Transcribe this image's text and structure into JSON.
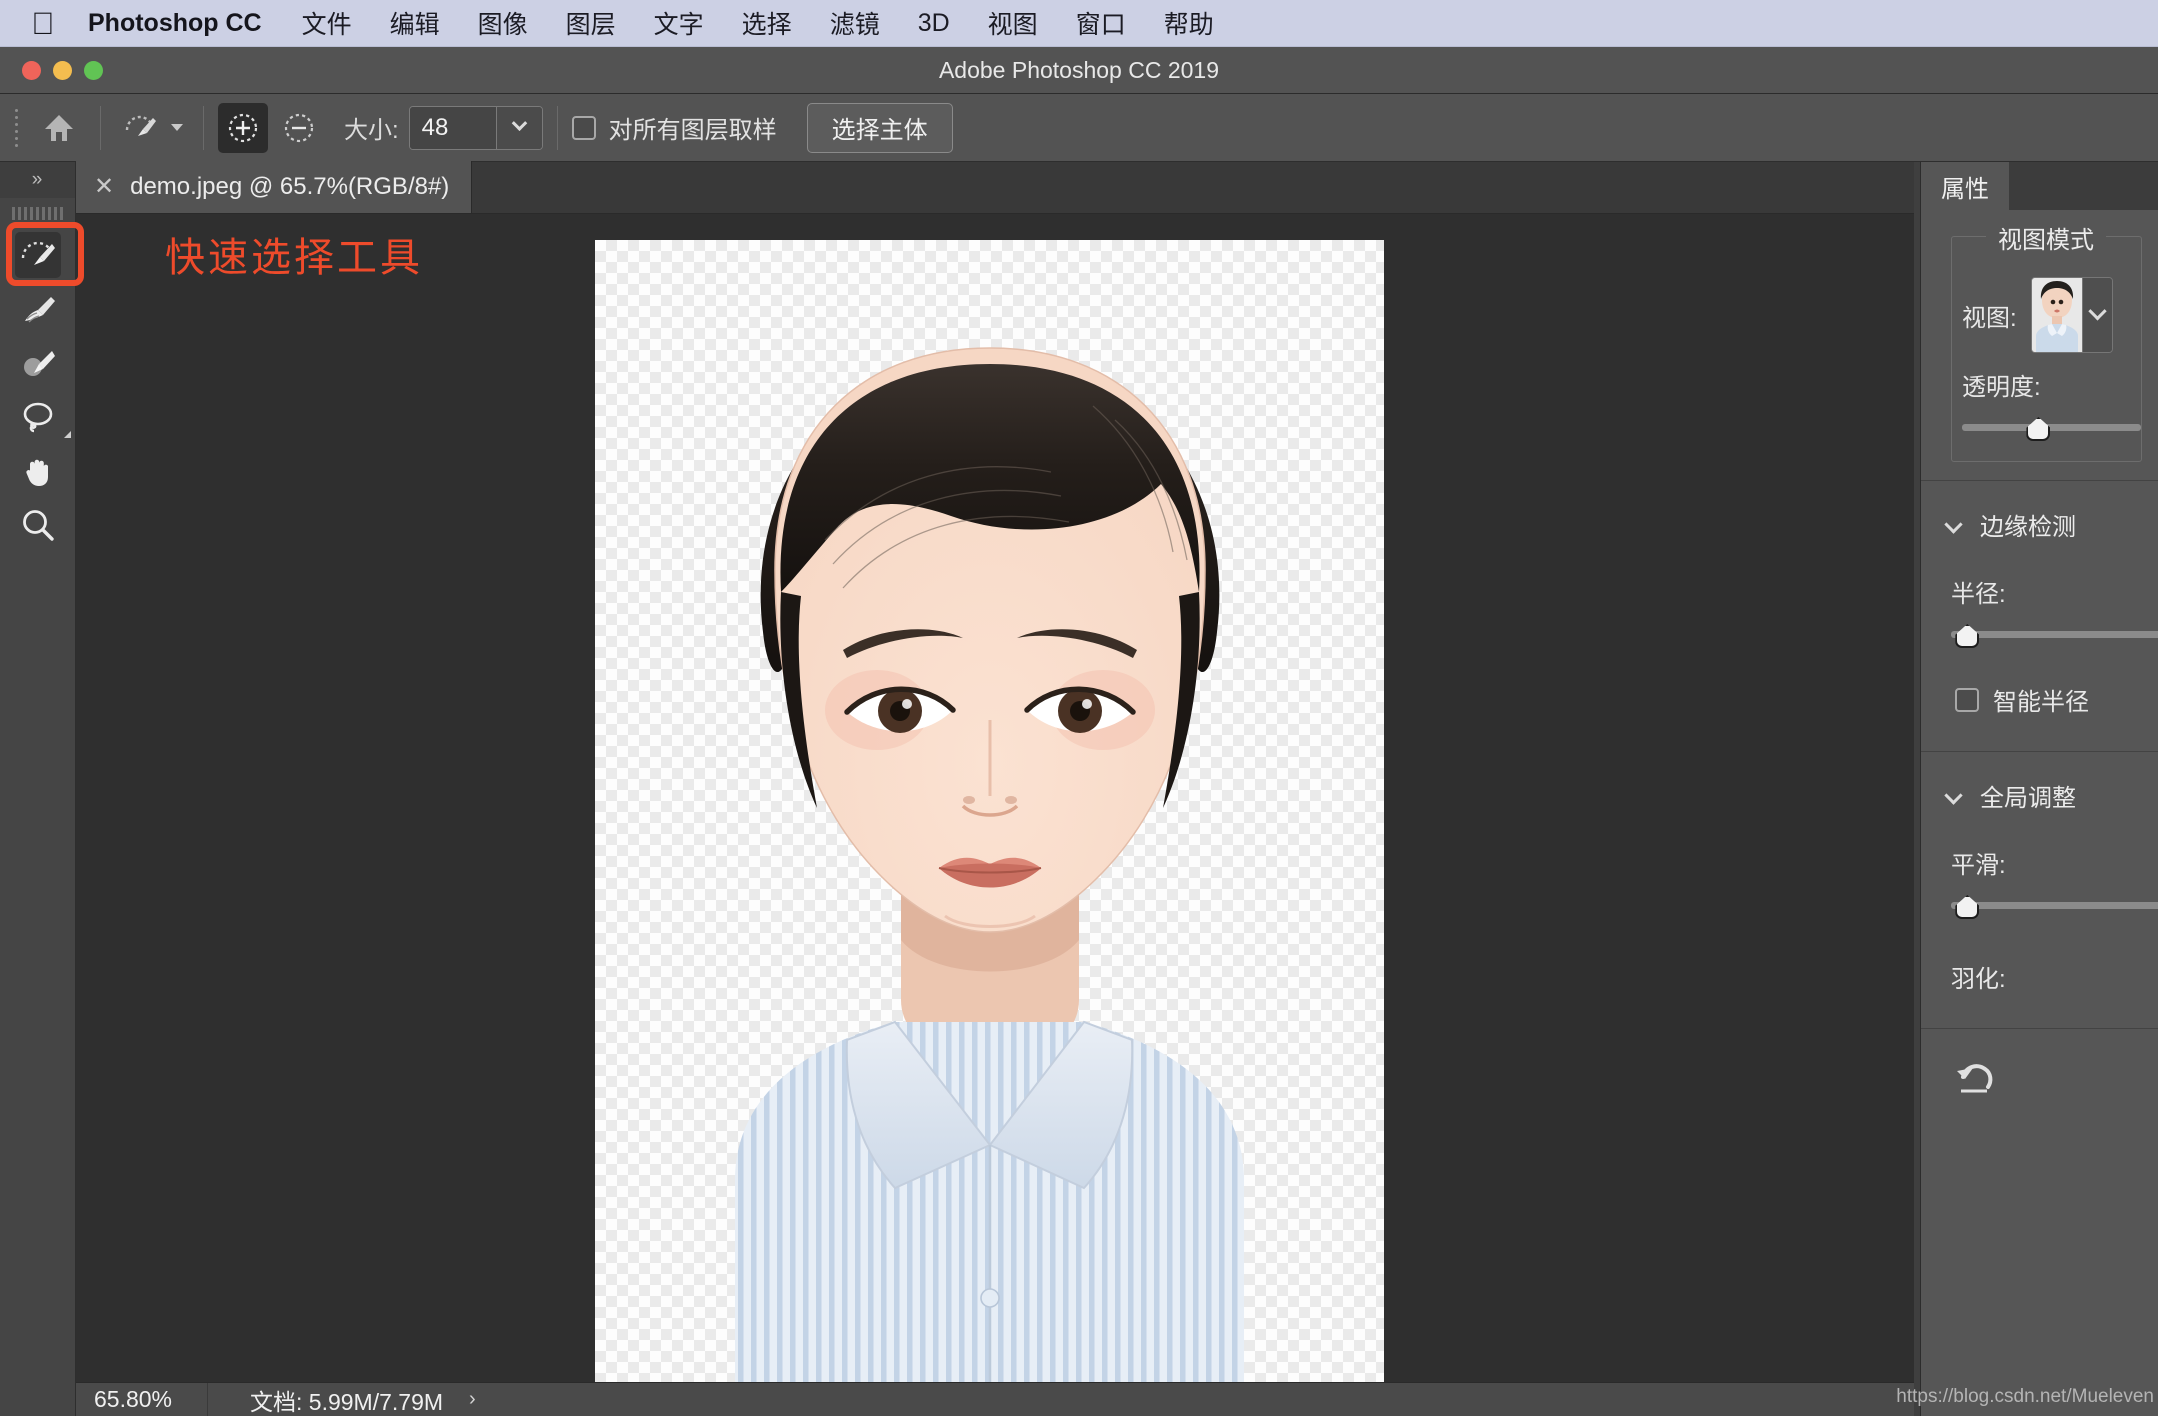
{
  "menubar": {
    "apple_icon": "apple-logo-icon",
    "app_name": "Photoshop CC",
    "items": [
      {
        "label": "文件"
      },
      {
        "label": "编辑"
      },
      {
        "label": "图像"
      },
      {
        "label": "图层"
      },
      {
        "label": "文字"
      },
      {
        "label": "选择"
      },
      {
        "label": "滤镜"
      },
      {
        "label": "3D"
      },
      {
        "label": "视图"
      },
      {
        "label": "窗口"
      },
      {
        "label": "帮助"
      }
    ]
  },
  "window": {
    "title": "Adobe Photoshop CC 2019",
    "close_label": "",
    "minimize_label": "",
    "maximize_label": ""
  },
  "options_bar": {
    "home_icon": "home-icon",
    "tool_preset_icon": "quick-selection-brush-icon",
    "preset_caret_icon": "chevron-down-icon",
    "add_to_selection_icon": "add-to-selection-icon",
    "subtract_from_selection_icon": "subtract-from-selection-icon",
    "size_label": "大小:",
    "size_value": "48",
    "size_dropdown_icon": "chevron-down-icon",
    "sample_all_layers_label": "对所有图层取样",
    "sample_all_layers_checked": false,
    "select_subject_label": "选择主体"
  },
  "toolbar": {
    "collapse_label": "»",
    "tools": [
      {
        "name": "quick-selection-tool",
        "icon": "quick-selection-brush-icon",
        "selected": true
      },
      {
        "name": "refine-edge-brush-tool",
        "icon": "refine-edge-brush-icon",
        "selected": false
      },
      {
        "name": "brush-tool",
        "icon": "brush-icon",
        "selected": false
      },
      {
        "name": "lasso-tool",
        "icon": "lasso-icon",
        "selected": false,
        "has_flyout": true
      },
      {
        "name": "hand-tool",
        "icon": "hand-icon",
        "selected": false
      },
      {
        "name": "zoom-tool",
        "icon": "magnifier-icon",
        "selected": false
      }
    ]
  },
  "annotation": {
    "text": "快速选择工具",
    "color": "#ee4b2b"
  },
  "document_tab": {
    "close_icon": "close-icon",
    "title": "demo.jpeg @ 65.7%(RGB/8#)"
  },
  "canvas": {
    "background_color": "#2f2f2f",
    "checkerboard": true,
    "image_description": "portrait-photo"
  },
  "status_bar": {
    "zoom_level": "65.80%",
    "document_info": "文档: 5.99M/7.79M",
    "expand_icon": "chevron-right-icon"
  },
  "properties_panel": {
    "tab_label": "属性",
    "view_mode": {
      "legend": "视图模式",
      "view_label": "视图:",
      "dropdown_icon": "chevron-down-icon",
      "thumbnail": "portrait-thumbnail"
    },
    "transparency": {
      "label": "透明度:",
      "handle_percent": 36
    },
    "edge_detection": {
      "title": "边缘检测",
      "collapse_icon": "chevron-down-icon",
      "radius": {
        "label": "半径:",
        "handle_percent": 2
      },
      "smart_radius": {
        "label": "智能半径",
        "checked": false
      }
    },
    "global_adjustments": {
      "title": "全局调整",
      "collapse_icon": "chevron-down-icon",
      "smooth": {
        "label": "平滑:",
        "handle_percent": 2
      },
      "feather": {
        "label": "羽化:"
      }
    },
    "reset_icon": "reset-arrow-icon",
    "watermark": "https://blog.csdn.net/Mueleven"
  }
}
